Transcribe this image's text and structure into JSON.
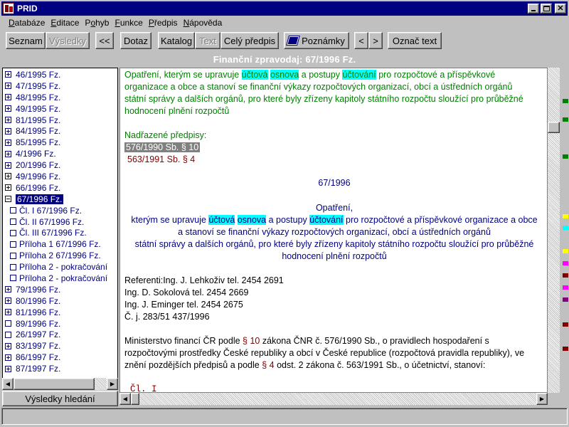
{
  "window": {
    "title": "PRID"
  },
  "menu": [
    {
      "pre": "",
      "ul": "D",
      "post": "atabáze"
    },
    {
      "pre": "",
      "ul": "E",
      "post": "ditace"
    },
    {
      "pre": "P",
      "ul": "o",
      "post": "hyb"
    },
    {
      "pre": "",
      "ul": "F",
      "post": "unkce"
    },
    {
      "pre": "",
      "ul": "P",
      "post": "ředpis"
    },
    {
      "pre": "",
      "ul": "N",
      "post": "ápověda"
    }
  ],
  "toolbar": {
    "seznam": "Seznam",
    "vysledky": "Výsledky",
    "back": "<<",
    "dotaz": "Dotaz",
    "katalog": "Katalog",
    "text": "Text",
    "cely_predpis": "Celý předpis",
    "poznamky": "Poznámky",
    "prev": "<",
    "next": ">",
    "oznac_text": "Označ text"
  },
  "header": {
    "title": "Finanční zpravodaj:   67/1996 Fz."
  },
  "tree": [
    {
      "label": "46/1995 Fz.",
      "state": "plus"
    },
    {
      "label": "47/1995 Fz.",
      "state": "plus"
    },
    {
      "label": "48/1995 Fz.",
      "state": "plus"
    },
    {
      "label": "49/1995 Fz.",
      "state": "plus"
    },
    {
      "label": "81/1995 Fz.",
      "state": "plus"
    },
    {
      "label": "84/1995 Fz.",
      "state": "plus"
    },
    {
      "label": "85/1995 Fz.",
      "state": "plus"
    },
    {
      "label": "4/1996 Fz.",
      "state": "plus"
    },
    {
      "label": "20/1996 Fz.",
      "state": "plus"
    },
    {
      "label": "49/1996 Fz.",
      "state": "plus"
    },
    {
      "label": "66/1996 Fz.",
      "state": "plus"
    },
    {
      "label": "67/1996 Fz.",
      "state": "minus",
      "selected": true
    },
    {
      "label": "Čl. I 67/1996 Fz.",
      "state": "leaf",
      "child": true
    },
    {
      "label": "Čl. II 67/1996 Fz.",
      "state": "leaf",
      "child": true
    },
    {
      "label": "Čl. III 67/1996 Fz.",
      "state": "leaf",
      "child": true
    },
    {
      "label": "Příloha 1 67/1996 Fz.",
      "state": "leaf",
      "child": true
    },
    {
      "label": "Příloha 2 67/1996 Fz.",
      "state": "leaf",
      "child": true
    },
    {
      "label": "Příloha 2 - pokračování",
      "state": "leaf",
      "child": true
    },
    {
      "label": "Příloha 2 - pokračování",
      "state": "leaf",
      "child": true
    },
    {
      "label": "79/1996 Fz.",
      "state": "plus"
    },
    {
      "label": "80/1996 Fz.",
      "state": "plus"
    },
    {
      "label": "81/1996 Fz.",
      "state": "plus"
    },
    {
      "label": "89/1996 Fz.",
      "state": "leaf"
    },
    {
      "label": "26/1997 Fz.",
      "state": "leaf"
    },
    {
      "label": "83/1997 Fz.",
      "state": "plus"
    },
    {
      "label": "86/1997 Fz.",
      "state": "plus"
    },
    {
      "label": "87/1997 Fz.",
      "state": "plus"
    }
  ],
  "search_results_label": "Výsledky hledání",
  "document": {
    "intro_a": "Opatření, kterým se upravuje ",
    "intro_hl1": "účtová",
    "intro_sp": " ",
    "intro_hl2": "osnova",
    "intro_b": " a postupy ",
    "intro_hl3": "účtování",
    "intro_c": " pro rozpočtové a příspěvkové",
    "intro_line2": "organizace a obce a stanoví se finanční výkazy rozpočtových  organizací, obcí a ústředních orgánů",
    "intro_line3": "státní správy a dalších orgánů, pro které byly zřízeny kapitoly státního rozpočtu sloužící pro průběžné",
    "intro_line4": "hodnocení plnění  rozpočtů",
    "nadrazene_label": "Nadřazené předpisy:",
    "ref1": "576/1990 Sb. § 10",
    "ref2": "563/1991 Sb. § 4",
    "number": "67/1996",
    "opatreni": "Opatření,",
    "title_a": "kterým se upravuje ",
    "title_hl1": "účtová",
    "title_sp": " ",
    "title_hl2": "osnova",
    "title_b": " a postupy ",
    "title_hl3": "účtování",
    "title_c": " pro rozpočtové a příspěvkové organizace a obce",
    "title_line2": "a stanoví se finanční výkazy rozpočtových organizací, obcí a ústředních orgánů",
    "title_line3": "státní správy a dalších orgánů, pro které byly zřízeny kapitoly státního rozpočtu sloužící pro průběžné",
    "title_line4": "hodnocení plnění rozpočtů",
    "referenti": [
      "Referenti:Ing. J. Lehkoživ tel. 2454 2691",
      "Ing. D. Sokolová tel. 2454 2669",
      "Ing. J. Eminger tel. 2454 2675",
      "Č. j. 283/51 437/1996"
    ],
    "body_a": "Ministerstvo financí ČR podle ",
    "body_link1": "§ 10",
    "body_b": " zákona ČNR č. 576/1990 Sb., o pravidlech hospodaření s",
    "body_line2": "rozpočtovými prostředky České republiky a obcí v České republice (rozpočtová pravidla republiky), ve",
    "body_c": "znění pozdějších předpisů a podle ",
    "body_link2": "§ 4",
    "body_d": " odst. 2 zákona č. 563/1991 Sb., o účetnictví, stanoví:",
    "clanek": "Čl. I"
  },
  "colors": {
    "titlebar": "#000080",
    "green_text": "#008000",
    "navy_text": "#000080",
    "link_text": "#800000",
    "highlight": "#00ffff"
  }
}
